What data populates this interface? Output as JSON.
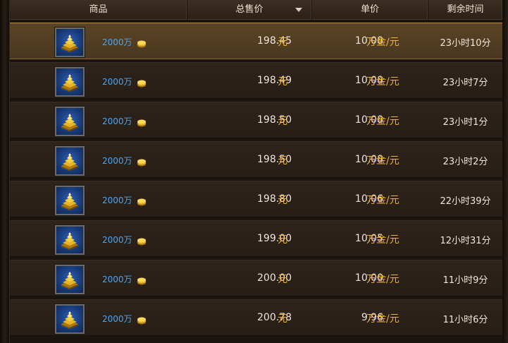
{
  "header": {
    "col_item": "商品",
    "col_total": "总售价",
    "col_unit": "单价",
    "col_time": "剩余时间"
  },
  "icons": {
    "item": "gold-ingot-pile-icon",
    "coin": "gold-coin-icon",
    "sort": "sort-descending-icon"
  },
  "colors": {
    "currency_accent": "#f0b030",
    "item_name": "#4aa6f2",
    "selected_row": "#5a4426"
  },
  "listings": [
    {
      "name": "2000万",
      "price": "198.45",
      "price_unit": "元",
      "unit_price": "10.08",
      "unit_label": "万金/元",
      "time_left": "23小时10分",
      "selected": true
    },
    {
      "name": "2000万",
      "price": "198.49",
      "price_unit": "元",
      "unit_price": "10.08",
      "unit_label": "万金/元",
      "time_left": "23小时7分"
    },
    {
      "name": "2000万",
      "price": "198.50",
      "price_unit": "元",
      "unit_price": "10.08",
      "unit_label": "万金/元",
      "time_left": "23小时1分"
    },
    {
      "name": "2000万",
      "price": "198.50",
      "price_unit": "元",
      "unit_price": "10.08",
      "unit_label": "万金/元",
      "time_left": "23小时2分"
    },
    {
      "name": "2000万",
      "price": "198.80",
      "price_unit": "元",
      "unit_price": "10.06",
      "unit_label": "万金/元",
      "time_left": "22小时39分"
    },
    {
      "name": "2000万",
      "price": "199.00",
      "price_unit": "元",
      "unit_price": "10.05",
      "unit_label": "万金/元",
      "time_left": "12小时31分"
    },
    {
      "name": "2000万",
      "price": "200.00",
      "price_unit": "元",
      "unit_price": "10.00",
      "unit_label": "万金/元",
      "time_left": "11小时9分"
    },
    {
      "name": "2000万",
      "price": "200.78",
      "price_unit": "元",
      "unit_price": "9.96",
      "unit_label": "万金/元",
      "time_left": "11小时6分"
    }
  ]
}
